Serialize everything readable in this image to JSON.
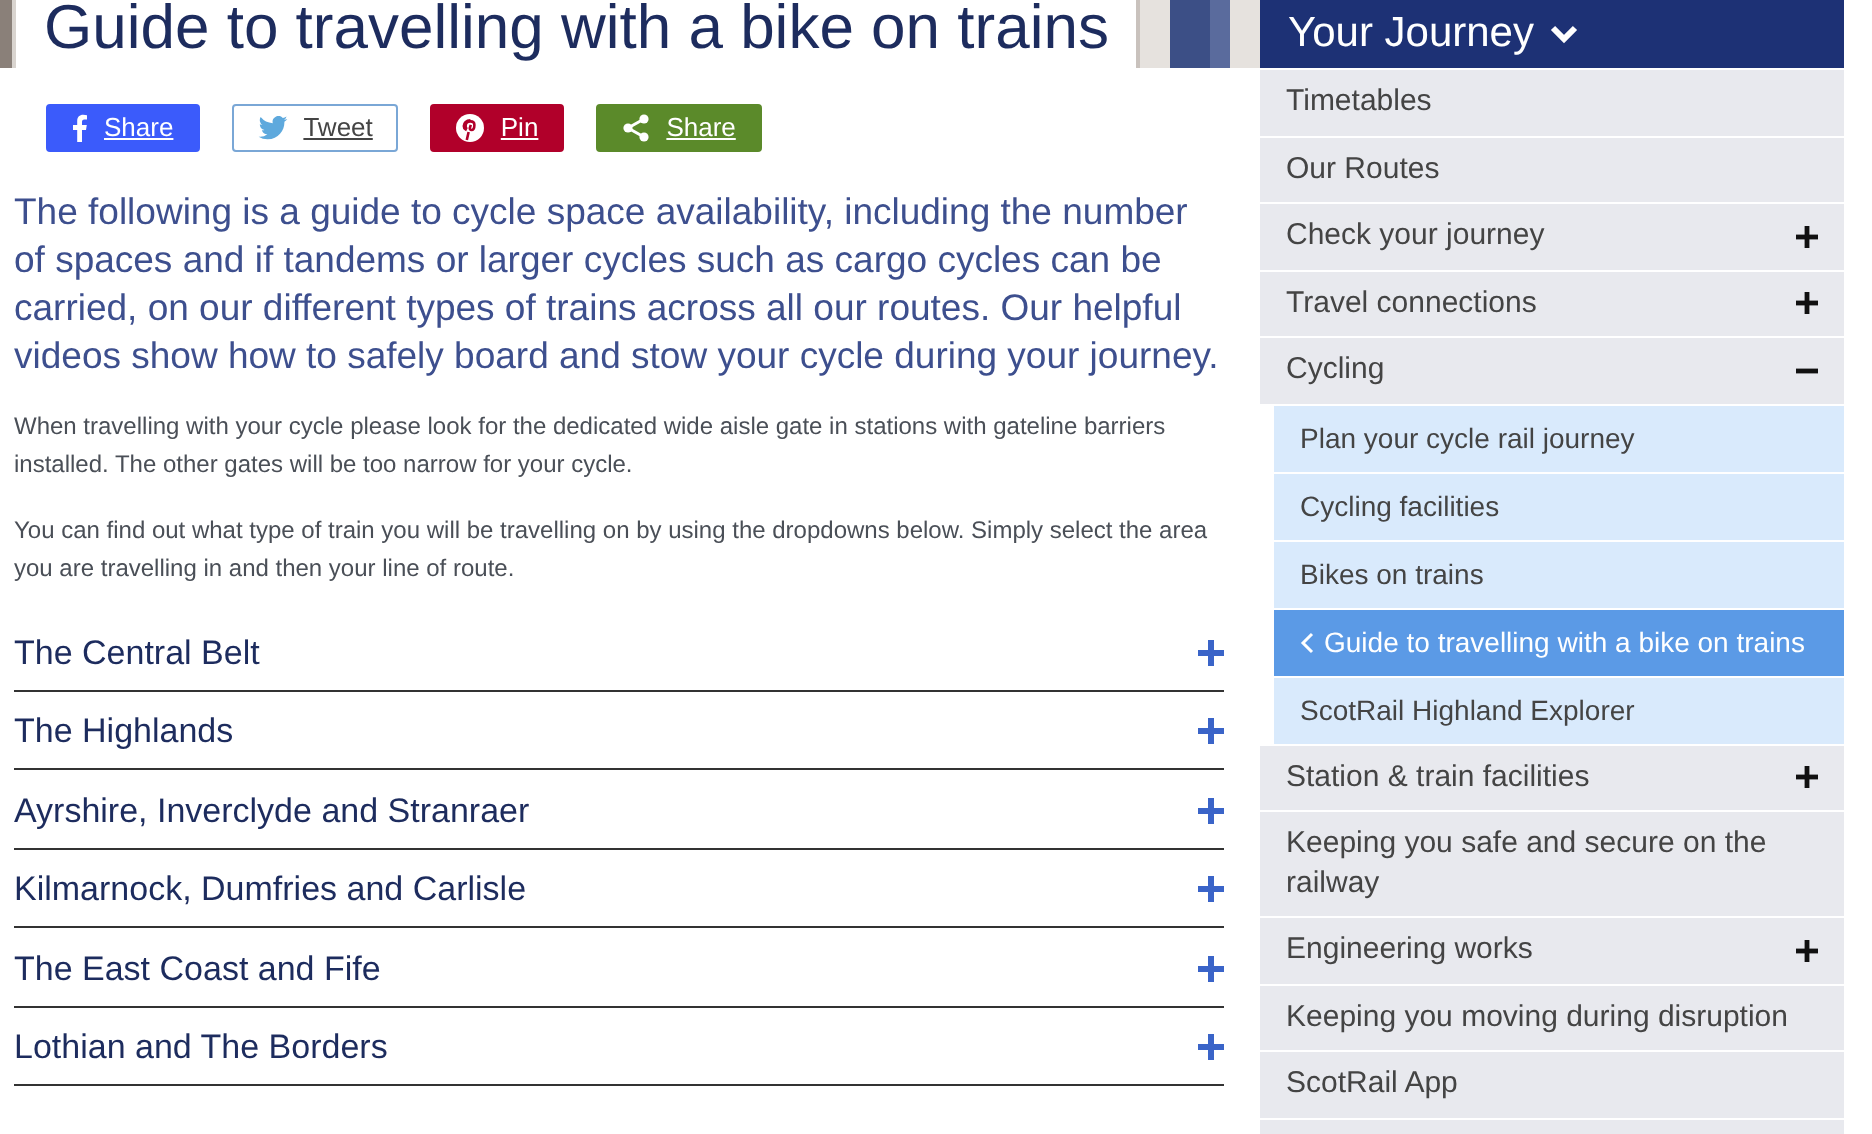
{
  "page": {
    "title": "Guide to travelling with a bike on trains"
  },
  "share_buttons": [
    {
      "kind": "facebook",
      "label": "Share"
    },
    {
      "kind": "twitter",
      "label": "Tweet"
    },
    {
      "kind": "pinterest",
      "label": "Pin"
    },
    {
      "kind": "share",
      "label": "Share"
    }
  ],
  "intro": "The following is a guide to cycle space availability, including the number of spaces and if tandems or larger cycles such as cargo cycles can be carried, on our different types of trains across all our routes. Our helpful videos show how to safely board and stow your cycle during your journey.",
  "paragraphs": [
    "When travelling with your cycle please look for the dedicated wide aisle gate in stations with gateline barriers installed. The other gates will be too narrow for your cycle.",
    "You can find out what type of train you will be travelling on by using the dropdowns below. Simply select the area you are travelling in and then your line of route."
  ],
  "accordion": [
    {
      "label": "The Central Belt",
      "expanded": false
    },
    {
      "label": "The Highlands",
      "expanded": false
    },
    {
      "label": "Ayrshire, Inverclyde and Stranraer",
      "expanded": false
    },
    {
      "label": "Kilmarnock, Dumfries and Carlisle",
      "expanded": false
    },
    {
      "label": "The East Coast and Fife",
      "expanded": false
    },
    {
      "label": "Lothian and The Borders",
      "expanded": false
    }
  ],
  "sidebar": {
    "title": "Your Journey",
    "items": [
      {
        "kind": "link",
        "label": "Timetables"
      },
      {
        "kind": "link",
        "label": "Our Routes"
      },
      {
        "kind": "group",
        "label": "Check your journey",
        "expanded": false
      },
      {
        "kind": "group",
        "label": "Travel connections",
        "expanded": false
      },
      {
        "kind": "group",
        "label": "Cycling",
        "expanded": true,
        "children": [
          {
            "label": "Plan your cycle rail journey",
            "selected": false
          },
          {
            "label": "Cycling facilities",
            "selected": false
          },
          {
            "label": "Bikes on trains",
            "selected": false
          },
          {
            "label": "Guide to travelling with a bike on trains",
            "selected": true
          },
          {
            "label": "ScotRail Highland Explorer",
            "selected": false
          }
        ]
      },
      {
        "kind": "group",
        "label": "Station & train facilities",
        "expanded": false
      },
      {
        "kind": "link",
        "label": "Keeping you safe and secure on the railway"
      },
      {
        "kind": "group",
        "label": "Engineering works",
        "expanded": false
      },
      {
        "kind": "link",
        "label": "Keeping you moving during disruption"
      },
      {
        "kind": "link",
        "label": "ScotRail App"
      },
      {
        "kind": "blank"
      }
    ]
  }
}
